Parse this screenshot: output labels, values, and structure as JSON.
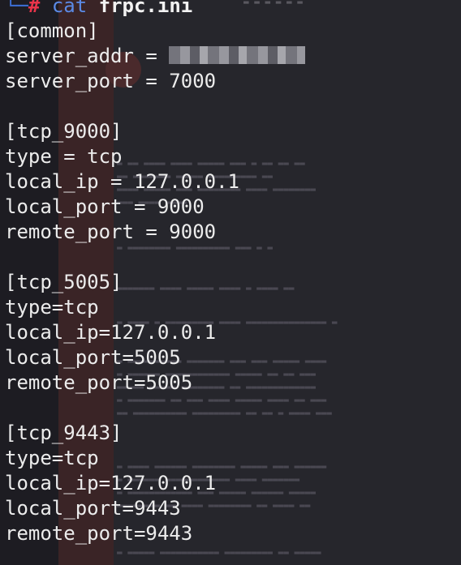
{
  "prompt": {
    "corner": "└─",
    "hash": "#",
    "command": "cat",
    "argument": "frpc.ini"
  },
  "file_lines": [
    "[common]",
    "server_addr = ",
    "server_port = 7000",
    "",
    "[tcp_9000]",
    "type = tcp",
    "local_ip = 127.0.0.1",
    "local_port = 9000",
    "remote_port = 9000",
    "",
    "[tcp_5005]",
    "type=tcp",
    "local_ip=127.0.0.1",
    "local_port=5005",
    "remote_port=5005",
    "",
    "[tcp_9443]",
    "type=tcp",
    "local_ip=127.0.0.1",
    "local_port=9443",
    "remote_port=9443"
  ],
  "redacted_value_line": 1,
  "colors": {
    "prompt_corner": "#3d6fd6",
    "prompt_hash": "#e8344a",
    "command": "#5b8ae6",
    "text": "#ececec",
    "background": "#1a1a20"
  }
}
